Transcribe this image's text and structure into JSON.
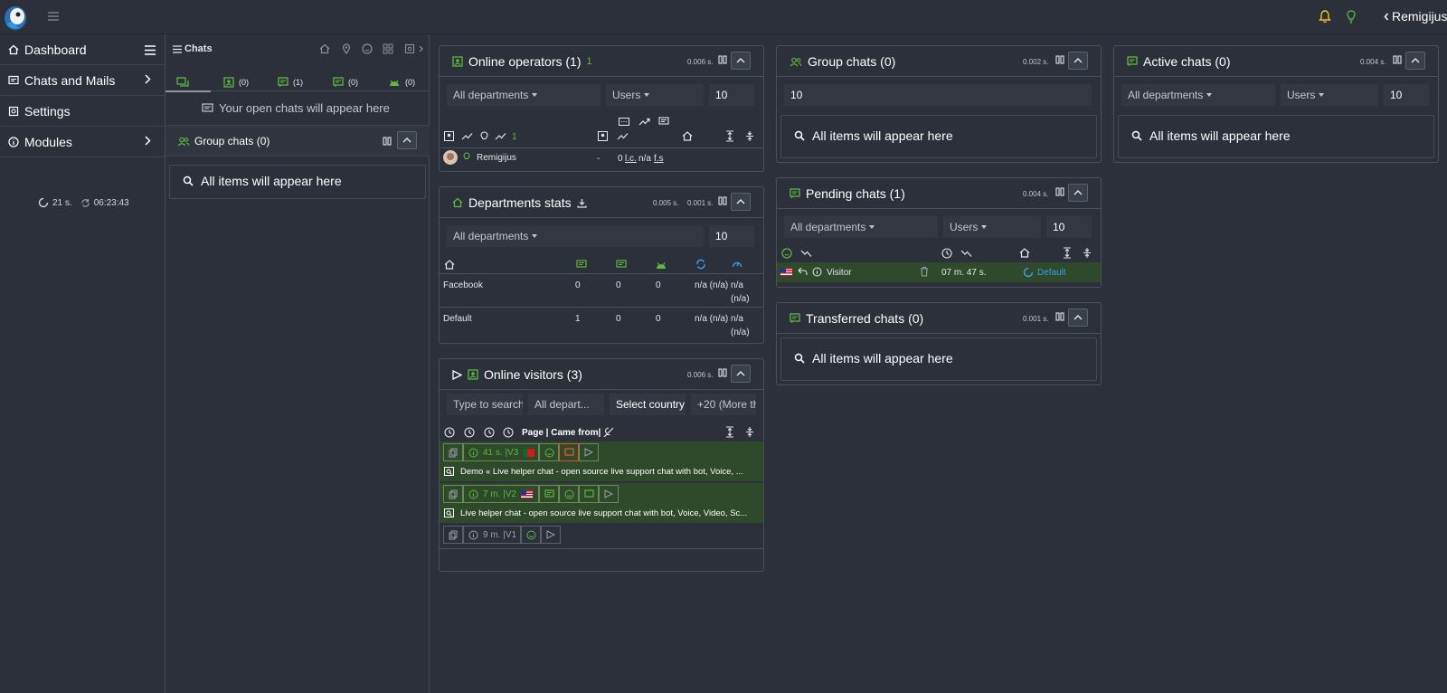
{
  "topbar": {
    "username": "Remigijus"
  },
  "leftnav": {
    "items": [
      {
        "label": "Dashboard"
      },
      {
        "label": "Chats and Mails"
      },
      {
        "label": "Settings"
      },
      {
        "label": "Modules"
      }
    ],
    "status_seconds": "21 s.",
    "status_clock": "06:23:43"
  },
  "chats_panel": {
    "title": "Chats",
    "tabs": [
      {
        "count": ""
      },
      {
        "count": "(0)"
      },
      {
        "count": "(1)"
      },
      {
        "count": "(0)"
      },
      {
        "count": "(0)"
      }
    ],
    "open_chats_text": "Your open chats will appear here",
    "group_chats_title": "Group chats (0)",
    "empty_text": "All items will appear here"
  },
  "online_operators": {
    "title": "Online operators (1)",
    "count_badge": "1",
    "time": "0.006 s.",
    "department_filter": "All departments",
    "users_filter": "Users",
    "limit": "10",
    "header_count": "1",
    "operator_name": "Remigijus",
    "operator_dash": "-",
    "operator_stats_prefix": "0",
    "operator_stats_lc": "l.c.",
    "operator_stats_mid": "n/a",
    "operator_stats_fs": "f.s"
  },
  "departments_stats": {
    "title": "Departments stats",
    "time1": "0.005 s.",
    "time2": "0.001 s.",
    "department_filter": "All departments",
    "limit": "10",
    "rows": [
      {
        "name": "Facebook",
        "c1": "0",
        "c2": "0",
        "c3": "0",
        "c4a": "n/a (n/a) n/a",
        "c4b": "(n/a)"
      },
      {
        "name": "Default",
        "c1": "1",
        "c2": "0",
        "c3": "0",
        "c4a": "n/a (n/a) n/a",
        "c4b": "(n/a)"
      }
    ]
  },
  "online_visitors": {
    "title": "Online visitors (3)",
    "time": "0.006 s.",
    "search_placeholder": "Type to search",
    "department_filter": "All depart...",
    "country_filter": "Select country",
    "more_filter": "+20 (More th",
    "column_label": "Page | Came from|",
    "visitors": [
      {
        "time": "41 s. |V3",
        "page": "Demo « Live helper chat - open source live support chat with bot, Voice, ..."
      },
      {
        "time": "7 m. |V2",
        "page": "Live helper chat - open source live support chat with bot, Voice, Video, Sc..."
      },
      {
        "time": "9 m. |V1",
        "page": ""
      }
    ]
  },
  "group_chats": {
    "title": "Group chats (0)",
    "time": "0.002 s.",
    "limit": "10",
    "empty_text": "All items will appear here"
  },
  "pending_chats": {
    "title": "Pending chats (1)",
    "time": "0.004 s.",
    "department_filter": "All departments",
    "users_filter": "Users",
    "limit": "10",
    "row": {
      "name": "Visitor",
      "wait": "07 m. 47 s.",
      "department": "Default"
    }
  },
  "transferred_chats": {
    "title": "Transferred chats (0)",
    "time": "0.001 s.",
    "empty_text": "All items will appear here"
  },
  "active_chats": {
    "title": "Active chats (0)",
    "time": "0.004 s.",
    "department_filter": "All departments",
    "users_filter": "Users",
    "limit": "10",
    "empty_text": "All items will appear here"
  },
  "colors": {
    "background": "#2b303a",
    "accent_green": "#5fb83f",
    "accent_blue": "#3aa0f0",
    "visitor_row": "#2e4a2a",
    "bell": "#f0c419"
  }
}
